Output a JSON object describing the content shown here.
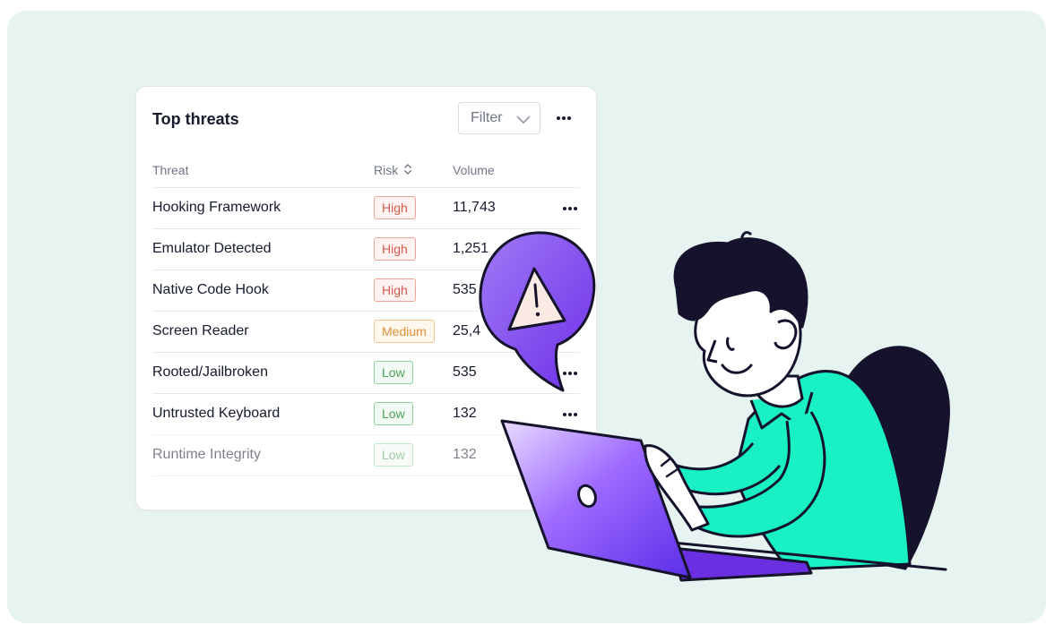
{
  "panel": {
    "title": "Top threats",
    "filter_label": "Filter",
    "columns": {
      "threat": "Threat",
      "risk": "Risk",
      "volume": "Volume"
    },
    "rows": [
      {
        "threat": "Hooking Framework",
        "risk": "High",
        "volume": "11,743"
      },
      {
        "threat": "Emulator Detected",
        "risk": "High",
        "volume": "1,251"
      },
      {
        "threat": "Native Code Hook",
        "risk": "High",
        "volume": "535"
      },
      {
        "threat": "Screen Reader",
        "risk": "Medium",
        "volume": "25,4"
      },
      {
        "threat": "Rooted/Jailbroken",
        "risk": "Low",
        "volume": "535"
      },
      {
        "threat": "Untrusted Keyboard",
        "risk": "Low",
        "volume": "132"
      },
      {
        "threat": "Runtime Integrity",
        "risk": "Low",
        "volume": "132"
      }
    ]
  },
  "icons": {
    "filter_chevron": "chevron-down-icon",
    "sort": "sort-icon",
    "more": "more-horizontal-icon",
    "warning": "warning-icon"
  },
  "colors": {
    "background": "#e6f3f1",
    "high": "#d2594b",
    "medium": "#e2913b",
    "low": "#4f9f5c",
    "laptop": "#7b3ff2",
    "shirt": "#19f0c3"
  }
}
